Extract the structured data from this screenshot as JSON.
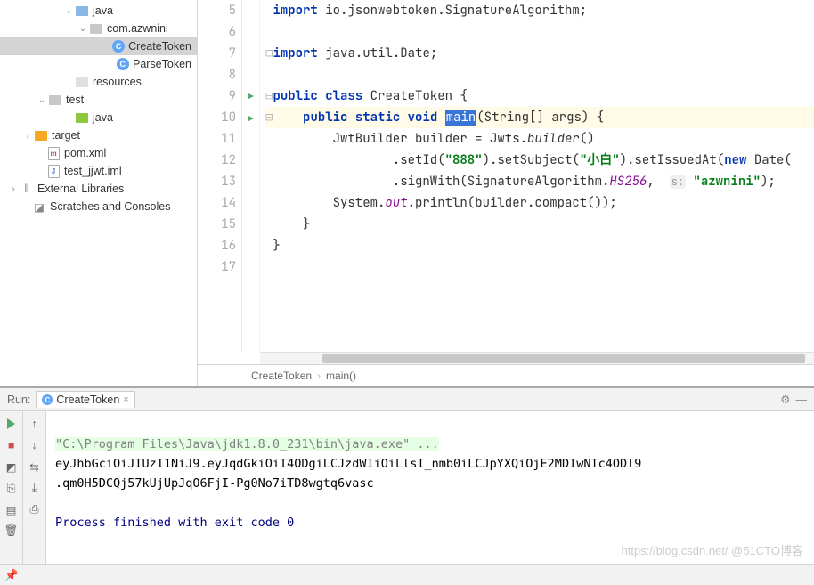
{
  "tree": {
    "items": [
      {
        "indent": 70,
        "arrow": "v",
        "icon": "folder-java",
        "label": "java"
      },
      {
        "indent": 86,
        "arrow": "v",
        "icon": "folder-pkg",
        "label": "com.azwnini"
      },
      {
        "indent": 118,
        "arrow": "",
        "icon": "class",
        "label": "CreateToken",
        "selected": true
      },
      {
        "indent": 118,
        "arrow": "",
        "icon": "class",
        "label": "ParseToken"
      },
      {
        "indent": 70,
        "arrow": "",
        "icon": "folder-res",
        "label": "resources"
      },
      {
        "indent": 40,
        "arrow": "v",
        "icon": "folder-pkg",
        "label": "test"
      },
      {
        "indent": 70,
        "arrow": "",
        "icon": "folder-src",
        "label": "java"
      },
      {
        "indent": 24,
        "arrow": ">",
        "icon": "folder-tgt",
        "label": "target"
      },
      {
        "indent": 38,
        "arrow": "",
        "icon": "file-m",
        "label": "pom.xml"
      },
      {
        "indent": 38,
        "arrow": "",
        "icon": "file-j",
        "label": "test_jjwt.iml"
      },
      {
        "indent": 8,
        "arrow": ">",
        "icon": "lib",
        "label": "External Libraries"
      },
      {
        "indent": 22,
        "arrow": "",
        "icon": "scratch",
        "label": "Scratches and Consoles"
      }
    ]
  },
  "code": {
    "lines": [
      {
        "n": 5,
        "run": false,
        "tokens": [
          {
            "t": "kw",
            "v": "import"
          },
          {
            "t": "",
            "v": " io.jsonwebtoken.SignatureAlgorithm;"
          }
        ]
      },
      {
        "n": 6,
        "run": false,
        "tokens": [
          {
            "t": "",
            "v": ""
          }
        ]
      },
      {
        "n": 7,
        "run": false,
        "fold": true,
        "tokens": [
          {
            "t": "kw",
            "v": "import"
          },
          {
            "t": "",
            "v": " java.util.Date;"
          }
        ]
      },
      {
        "n": 8,
        "run": false,
        "tokens": [
          {
            "t": "",
            "v": ""
          }
        ]
      },
      {
        "n": 9,
        "run": true,
        "fold": true,
        "tokens": [
          {
            "t": "kw",
            "v": "public class"
          },
          {
            "t": "",
            "v": " CreateToken {"
          }
        ]
      },
      {
        "n": 10,
        "run": true,
        "hl": true,
        "fold": true,
        "tokens": [
          {
            "t": "",
            "v": "    "
          },
          {
            "t": "kw",
            "v": "public static void"
          },
          {
            "t": "",
            "v": " "
          },
          {
            "t": "hl",
            "v": "main"
          },
          {
            "t": "",
            "v": "(String[] args) {"
          }
        ]
      },
      {
        "n": 11,
        "run": false,
        "tokens": [
          {
            "t": "",
            "v": "        JwtBuilder builder = Jwts."
          },
          {
            "t": "mi",
            "v": "builder"
          },
          {
            "t": "",
            "v": "()"
          }
        ]
      },
      {
        "n": 12,
        "run": false,
        "tokens": [
          {
            "t": "",
            "v": "                .setId("
          },
          {
            "t": "str",
            "v": "\"888\""
          },
          {
            "t": "",
            "v": ").setSubject("
          },
          {
            "t": "str",
            "v": "\"小白\""
          },
          {
            "t": "",
            "v": ").setIssuedAt("
          },
          {
            "t": "kw",
            "v": "new"
          },
          {
            "t": "",
            "v": " Date("
          }
        ]
      },
      {
        "n": 13,
        "run": false,
        "tokens": [
          {
            "t": "",
            "v": "                .signWith(SignatureAlgorithm."
          },
          {
            "t": "sf",
            "v": "HS256"
          },
          {
            "t": "",
            "v": ",  "
          },
          {
            "t": "hint",
            "v": "s:"
          },
          {
            "t": "",
            "v": " "
          },
          {
            "t": "str",
            "v": "\"azwnini\""
          },
          {
            "t": "",
            "v": ");"
          }
        ]
      },
      {
        "n": 14,
        "run": false,
        "tokens": [
          {
            "t": "",
            "v": "        System."
          },
          {
            "t": "sf",
            "v": "out"
          },
          {
            "t": "",
            "v": ".println(builder.compact());"
          }
        ]
      },
      {
        "n": 15,
        "run": false,
        "tokens": [
          {
            "t": "",
            "v": "    }"
          }
        ]
      },
      {
        "n": 16,
        "run": false,
        "tokens": [
          {
            "t": "",
            "v": "}"
          }
        ]
      },
      {
        "n": 17,
        "run": false,
        "tokens": [
          {
            "t": "",
            "v": ""
          }
        ]
      }
    ]
  },
  "breadcrumb": {
    "a": "CreateToken",
    "b": "main()"
  },
  "run": {
    "label": "Run:",
    "tab": "CreateToken",
    "cmd": "\"C:\\Program Files\\Java\\jdk1.8.0_231\\bin\\java.exe\" ...",
    "out1": "eyJhbGciOiJIUzI1NiJ9.eyJqdGkiOiI4ODgiLCJzdWIiOiLlsI_nmb0iLCJpYXQiOjE2MDIwNTc4ODl9",
    "out2": ".qm0H5DCQj57kUjUpJqO6FjI-Pg0No7iTD8wgtq6vasc",
    "exit": "Process finished with exit code 0"
  },
  "watermark": "https://blog.csdn.net/ @51CTO博客"
}
